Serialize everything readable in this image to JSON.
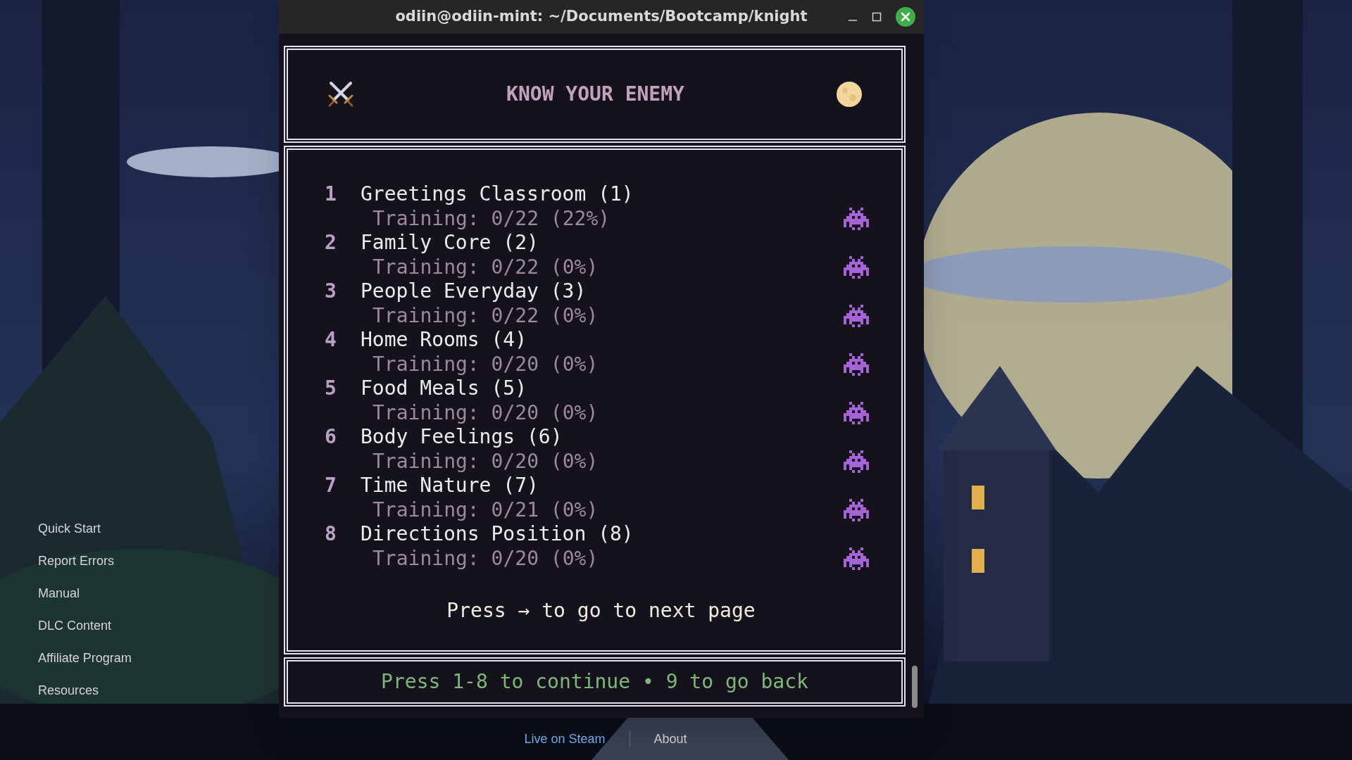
{
  "window": {
    "title": "odiin@odiin-mint: ~/Documents/Bootcamp/knight"
  },
  "header": {
    "title": "KNOW YOUR ENEMY"
  },
  "levels": [
    {
      "number": "1",
      "name": "Greetings Classroom (1)",
      "training": "Training: 0/22 (22%)"
    },
    {
      "number": "2",
      "name": "Family Core (2)",
      "training": "Training: 0/22 (0%)"
    },
    {
      "number": "3",
      "name": "People Everyday (3)",
      "training": "Training: 0/22 (0%)"
    },
    {
      "number": "4",
      "name": "Home Rooms (4)",
      "training": "Training: 0/20 (0%)"
    },
    {
      "number": "5",
      "name": "Food Meals (5)",
      "training": "Training: 0/20 (0%)"
    },
    {
      "number": "6",
      "name": "Body Feelings (6)",
      "training": "Training: 0/20 (0%)"
    },
    {
      "number": "7",
      "name": "Time Nature (7)",
      "training": "Training: 0/21 (0%)"
    },
    {
      "number": "8",
      "name": "Directions Position (8)",
      "training": "Training: 0/20 (0%)"
    }
  ],
  "pager_hint": "Press → to go to next page",
  "footer_hint": "Press 1-8 to continue • 9 to go back",
  "sidebar": {
    "items": [
      "Quick Start",
      "Report Errors",
      "Manual",
      "DLC Content",
      "Affiliate Program",
      "Resources"
    ]
  },
  "bottom_links": [
    {
      "label": "Live on Steam",
      "selected": true
    },
    {
      "label": "About",
      "selected": false
    }
  ]
}
